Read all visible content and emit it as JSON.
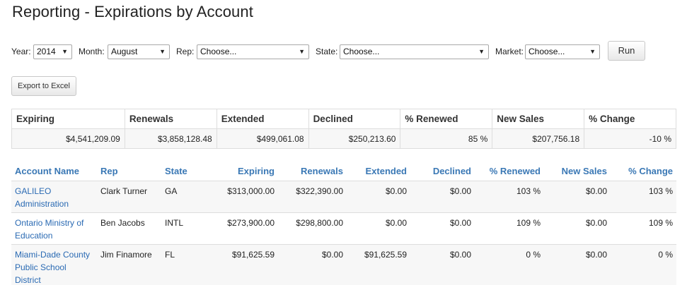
{
  "page": {
    "title": "Reporting - Expirations by Account"
  },
  "filters": {
    "year": {
      "label": "Year:",
      "value": "2014"
    },
    "month": {
      "label": "Month:",
      "value": "August"
    },
    "rep": {
      "label": "Rep:",
      "value": "Choose..."
    },
    "state": {
      "label": "State:",
      "value": "Choose..."
    },
    "market": {
      "label": "Market:",
      "value": "Choose..."
    },
    "run_label": "Run"
  },
  "export": {
    "label": "Export to Excel"
  },
  "summary": {
    "headers": [
      "Expiring",
      "Renewals",
      "Extended",
      "Declined",
      "% Renewed",
      "New Sales",
      "% Change"
    ],
    "values": [
      "$4,541,209.09",
      "$3,858,128.48",
      "$499,061.08",
      "$250,213.60",
      "85 %",
      "$207,756.18",
      "-10 %"
    ]
  },
  "detail": {
    "headers": [
      "Account Name",
      "Rep",
      "State",
      "Expiring",
      "Renewals",
      "Extended",
      "Declined",
      "% Renewed",
      "New Sales",
      "% Change"
    ],
    "rows": [
      [
        "GALILEO Administration",
        "Clark Turner",
        "GA",
        "$313,000.00",
        "$322,390.00",
        "$0.00",
        "$0.00",
        "103 %",
        "$0.00",
        "103 %"
      ],
      [
        "Ontario Ministry of Education",
        "Ben Jacobs",
        "INTL",
        "$273,900.00",
        "$298,800.00",
        "$0.00",
        "$0.00",
        "109 %",
        "$0.00",
        "109 %"
      ],
      [
        "Miami-Dade County Public School District",
        "Jim Finamore",
        "FL",
        "$91,625.59",
        "$0.00",
        "$91,625.59",
        "$0.00",
        "0 %",
        "$0.00",
        "0 %"
      ]
    ]
  }
}
